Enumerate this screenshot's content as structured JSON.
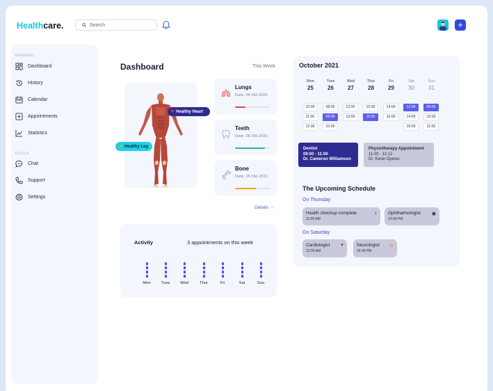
{
  "brand": {
    "part1": "Health",
    "part2": "care."
  },
  "search": {
    "placeholder": "Search"
  },
  "sidebar": {
    "section1": "GENERAL",
    "section2": "TOOLS",
    "items": [
      {
        "label": "Dashboard",
        "icon": "dashboard-icon"
      },
      {
        "label": "History",
        "icon": "history-icon"
      },
      {
        "label": "Calendar",
        "icon": "calendar-icon"
      },
      {
        "label": "Appointments",
        "icon": "appointments-icon"
      },
      {
        "label": "Statistics",
        "icon": "statistics-icon"
      },
      {
        "label": "Chat",
        "icon": "chat-icon"
      },
      {
        "label": "Support",
        "icon": "phone-icon"
      },
      {
        "label": "Settings",
        "icon": "gear-icon"
      }
    ]
  },
  "dashboard": {
    "title": "Dashboard",
    "period": "This Week",
    "tags": {
      "heart": "Healthy Heart",
      "leg": "Healthy Leg"
    },
    "organs": [
      {
        "name": "Lungs",
        "date": "Date: 26 Okt 2021",
        "progress": 0.3,
        "color": "#e0474c"
      },
      {
        "name": "Teeth",
        "date": "Date: 26 Okt 2021",
        "progress": 0.85,
        "color": "#2fb39c"
      },
      {
        "name": "Bone",
        "date": "Date: 26 Okt 2021",
        "progress": 0.6,
        "color": "#f0a020"
      }
    ],
    "details_link": "Details →"
  },
  "activity": {
    "title": "Activity",
    "summary": "3 appointments on this week",
    "days": [
      "Mon",
      "Tues",
      "Wed",
      "Thur",
      "Fri",
      "Sat",
      "Sun"
    ]
  },
  "calendar": {
    "month": "October 2021",
    "days": [
      {
        "name": "Mon",
        "date": "25",
        "slots": [
          {
            "t": "10:00",
            "on": false
          },
          {
            "t": "11:00",
            "on": false
          },
          {
            "t": "12:00",
            "on": false
          }
        ]
      },
      {
        "name": "Tues",
        "date": "26",
        "slots": [
          {
            "t": "08:00",
            "on": false
          },
          {
            "t": "09:00",
            "on": true
          },
          {
            "t": "10:00",
            "on": false
          }
        ]
      },
      {
        "name": "Wed",
        "date": "27",
        "slots": [
          {
            "t": "12:00",
            "on": false
          },
          {
            "t": "13:00",
            "on": false
          }
        ]
      },
      {
        "name": "Thur",
        "date": "28",
        "slots": [
          {
            "t": "10:00",
            "on": false
          },
          {
            "t": "11:00",
            "on": true
          }
        ]
      },
      {
        "name": "Fri",
        "date": "29",
        "slots": [
          {
            "t": "14:00",
            "on": false
          },
          {
            "t": "16:00",
            "on": false
          }
        ]
      },
      {
        "name": "Sat",
        "date": "30",
        "slots": [
          {
            "t": "12:00",
            "on": true
          },
          {
            "t": "14:00",
            "on": false
          },
          {
            "t": "15:00",
            "on": false
          }
        ]
      },
      {
        "name": "Sun",
        "date": "31",
        "slots": [
          {
            "t": "09:00",
            "on": true
          },
          {
            "t": "10:00",
            "on": false
          },
          {
            "t": "11:00",
            "on": false
          }
        ]
      }
    ],
    "appointments": [
      {
        "title": "Dentist",
        "time": "09:00 - 11:00",
        "doctor": "Dr. Cameron Williamson"
      },
      {
        "title": "Physiotherapy Appointment",
        "time": "11:00 - 11:12",
        "doctor": "Dr. Kevin Djones"
      }
    ]
  },
  "schedule": {
    "title": "The Upcoming Schedule",
    "groups": [
      {
        "day": "On Thursday",
        "items": [
          {
            "name": "Health checkup complete",
            "time": "11:00 AM",
            "icon": "stethoscope-icon"
          },
          {
            "name": "Ophthalmologist",
            "time": "14:00 PM",
            "icon": "eye-icon"
          }
        ]
      },
      {
        "day": "On Saturday",
        "items": [
          {
            "name": "Cardiologist",
            "time": "12:00 AM",
            "icon": "heart-icon"
          },
          {
            "name": "Neurologist",
            "time": "16:00 PM",
            "icon": "brain-icon"
          }
        ]
      }
    ]
  }
}
